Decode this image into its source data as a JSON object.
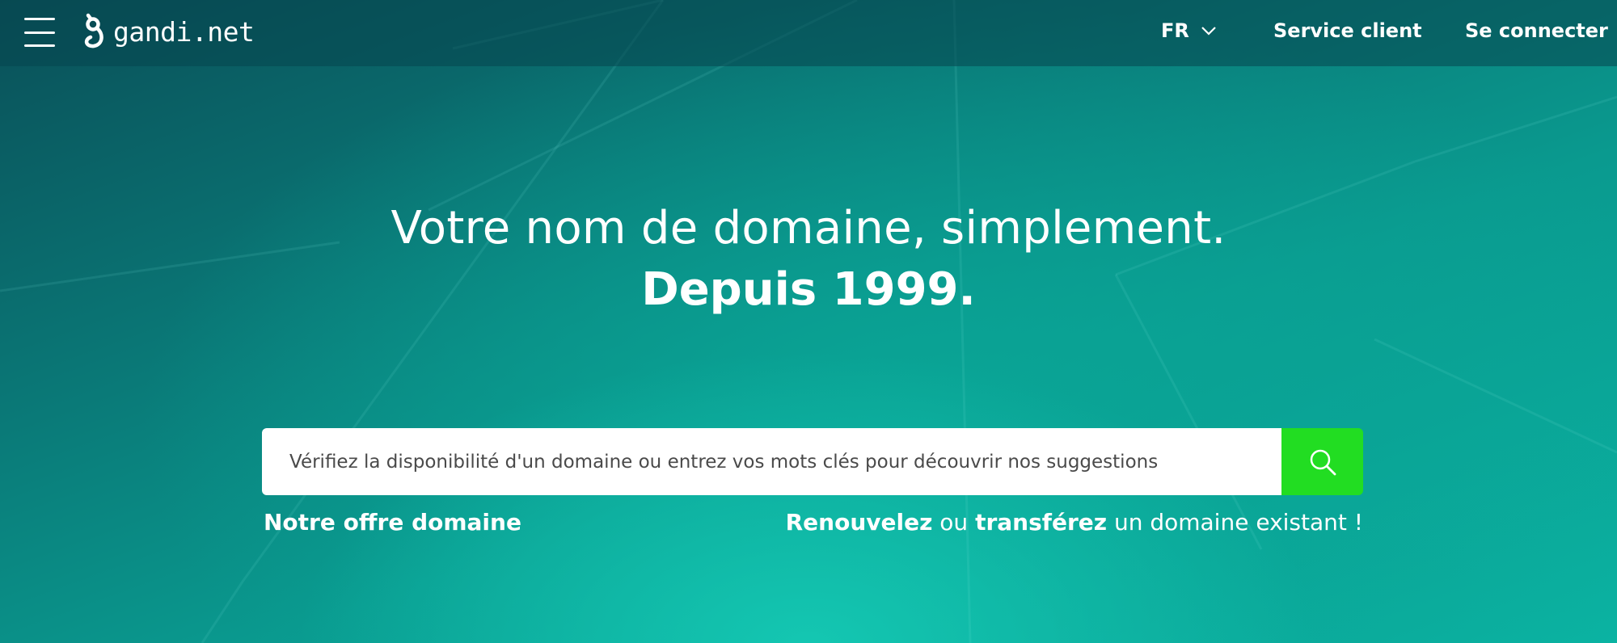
{
  "brand": {
    "name": "gandi.net"
  },
  "nav": {
    "language": "FR",
    "service": "Service client",
    "login": "Se connecter"
  },
  "hero": {
    "title": "Votre nom de domaine, simplement.",
    "subtitle": "Depuis 1999."
  },
  "search": {
    "placeholder": "Vérifiez la disponibilité d'un domaine ou entrez vos mots clés pour découvrir nos suggestions",
    "button_icon": "search-icon",
    "button_color": "#22dd22"
  },
  "links": {
    "offer": "Notre offre domaine",
    "renew": "Renouvelez",
    "or": " ou ",
    "transfer": "transférez",
    "existing": " un domaine existant !"
  },
  "colors": {
    "background_primary": "#0a9a8f",
    "background_dark": "#0a4f58",
    "text": "#ffffff"
  },
  "icons": [
    "menu-icon",
    "gandi-logo-icon",
    "chevron-down-icon",
    "search-icon"
  ]
}
